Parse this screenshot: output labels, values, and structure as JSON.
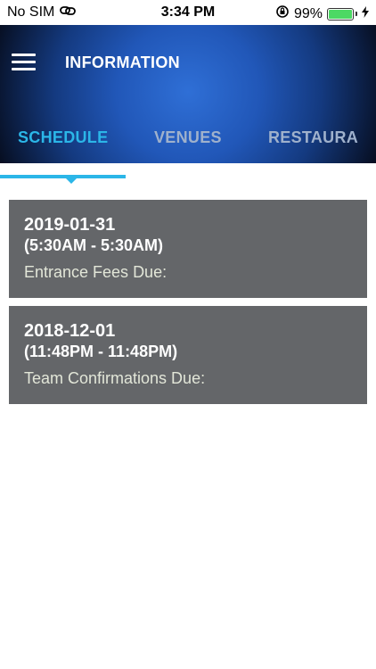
{
  "status_bar": {
    "carrier": "No SIM",
    "time": "3:34 PM",
    "battery_percent": "99%",
    "battery_level": 0.99,
    "battery_color": "#4cd964"
  },
  "header": {
    "title": "INFORMATION",
    "menu_icon": "hamburger-menu-icon"
  },
  "tabs": [
    {
      "label": "SCHEDULE",
      "active": true
    },
    {
      "label": "VENUES",
      "active": false
    },
    {
      "label": "RESTAURA",
      "active": false
    }
  ],
  "accent_color": "#2bb6e8",
  "schedule": [
    {
      "date": "2019-01-31",
      "time": "(5:30AM - 5:30AM)",
      "description": "Entrance Fees Due:"
    },
    {
      "date": "2018-12-01",
      "time": "(11:48PM - 11:48PM)",
      "description": "Team Confirmations Due:"
    }
  ]
}
